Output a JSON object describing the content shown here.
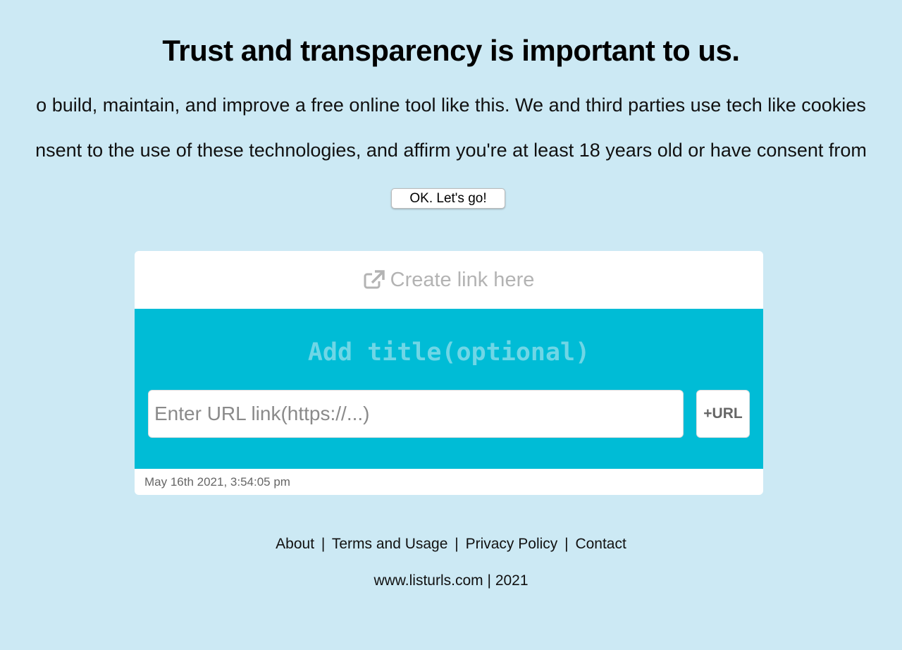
{
  "consent": {
    "heading": "Trust and transparency is important to us.",
    "line1": "o build, maintain, and improve a free online tool like this. We and third parties use tech like cookies",
    "line2": "nsent to the use of these technologies, and affirm you're at least 18 years old or have consent from",
    "ok_button": "OK. Let's go!"
  },
  "card": {
    "header_icon": "external-link-icon",
    "header_label": "Create link here",
    "title_placeholder": "Add title(optional)",
    "url_placeholder": "Enter URL link(https://...)",
    "add_url_button": "+URL",
    "timestamp": "May 16th 2021, 3:54:05 pm"
  },
  "footer": {
    "links": [
      "About",
      "Terms and Usage",
      "Privacy Policy",
      "Contact"
    ],
    "separator": "|",
    "site": "www.listurls.com",
    "year": "2021"
  }
}
